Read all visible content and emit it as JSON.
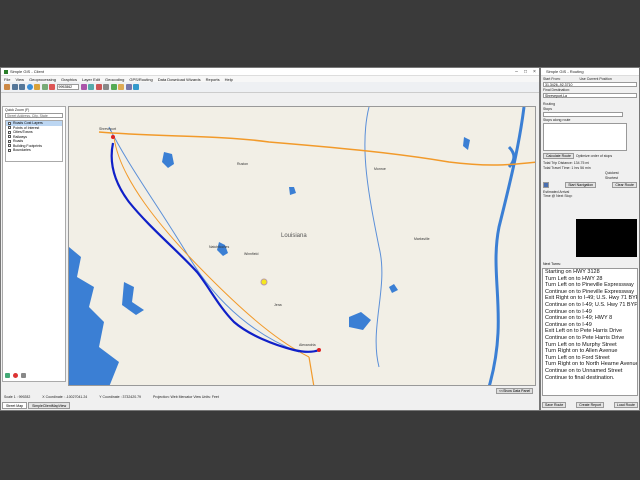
{
  "app": {
    "title": "Simple GIS - Client",
    "window_controls": [
      "–",
      "□",
      "×"
    ]
  },
  "menu": [
    "File",
    "View",
    "Geoprocessing",
    "Graphics",
    "Layer Edit",
    "Geocoding",
    "GPS/Routing",
    "Data Download Wizards",
    "Reports",
    "Help"
  ],
  "toolbar": {
    "scale_value": "9992862",
    "icons": [
      "pointer-icon",
      "zoom-in-icon",
      "zoom-out-icon",
      "pan-icon",
      "globe-icon",
      "identify-icon",
      "select-icon",
      "measure-icon",
      "scale-field",
      "vertex-icon",
      "line-icon",
      "polygon-icon",
      "text-icon",
      "table-icon",
      "layer-icon",
      "gear-icon",
      "help-icon"
    ]
  },
  "left_panel": {
    "quick_zoom_label": "Quick Zoom (F)",
    "address_placeholder": "Street Address, City, State",
    "layers": [
      {
        "name": "Roads Cost Layers",
        "selected": true
      },
      {
        "name": "Points of Interest",
        "selected": false
      },
      {
        "name": "Cities/Towns",
        "selected": false
      },
      {
        "name": "Railways",
        "selected": false
      },
      {
        "name": "Roads",
        "selected": false
      },
      {
        "name": "Building Footprints",
        "selected": false
      },
      {
        "name": "Boundaries",
        "selected": false
      }
    ]
  },
  "map": {
    "state_label": "Louisiana",
    "place_labels": [
      "Shreveport",
      "Natchitoches",
      "Alexandria",
      "Monroe",
      "Ruston",
      "Winnfield",
      "Jena",
      "Marksville"
    ],
    "accent_route": "#1020c8",
    "water": "#3b7fd4"
  },
  "status": {
    "scale": "Scale 1 : 999282",
    "x_coord": "X Coordinate : -10027041.24",
    "y_coord": "Y Coordinate : 3732420.79",
    "projection": "Projection: Web Mercator View Units: Feet",
    "show_data_panel": "<<Show Data Panel"
  },
  "tabs": [
    "Street Map",
    "SimpleClientMapView"
  ],
  "routing": {
    "title": "Simple GIS - Routing",
    "start_from_label": "Start From:",
    "use_current_position": "Use Current Position",
    "start_value": "31.3426,-92.3710",
    "final_dest_label": "Final Destination:",
    "final_dest_value": "Shreveport,La",
    "routing_label": "Routing",
    "stops_label": "Stops",
    "stops_along_route": "Stops along route",
    "calculate_route": "Calculate Route",
    "optimize_order": "Optimize order of stops",
    "total_distance": "Total Trip Distance: 134.75 mi",
    "total_time": "Total Travel Time: 1 hrs 56 min",
    "quickest": "Quickest",
    "shortest": "Shortest",
    "start_navigation": "Start Navigation",
    "clear_route": "Clear Route",
    "est_arrival": "Estimated Arrival Time @ Next Stop:",
    "next_turns": "Next Turns:",
    "directions": [
      "Starting on HWY 3128",
      "Turn Left on to HWY 28",
      "Turn Left on to Pineville Expressway",
      "Continue on to Pineville Expressway",
      "Exit Right on to I-49; U.S. Hwy 71 BYP",
      "Continue on to I-49; U.S. Hwy 71 BYP",
      "Continue on to I-49",
      "Continue on to I-49; HWY 8",
      "Continue on to I-49",
      "Exit Left on to Pete Harris Drive",
      "Continue on to Pete Harris Drive",
      "Turn Left on to Murphy Street",
      "Turn Right on to Allen Avenue",
      "Turn Left on to Ford Street",
      "Turn Right on to North Hearne Avenue",
      "Continue on to Unnamed Street",
      "Continue to final destination."
    ],
    "save_route": "Save Route",
    "create_report": "Create Report",
    "load_route": "Load Route"
  }
}
